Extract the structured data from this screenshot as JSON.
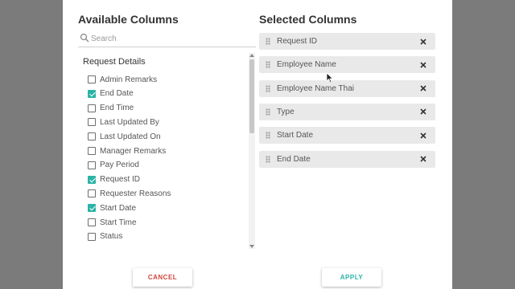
{
  "available_columns": {
    "title": "Available Columns",
    "search_placeholder": "Search",
    "group_title": "Request Details",
    "items": [
      {
        "label": "Admin Remarks",
        "checked": false
      },
      {
        "label": "End Date",
        "checked": true
      },
      {
        "label": "End Time",
        "checked": false
      },
      {
        "label": "Last Updated By",
        "checked": false
      },
      {
        "label": "Last Updated On",
        "checked": false
      },
      {
        "label": "Manager Remarks",
        "checked": false
      },
      {
        "label": "Pay Period",
        "checked": false
      },
      {
        "label": "Request ID",
        "checked": true
      },
      {
        "label": "Requester Reasons",
        "checked": false
      },
      {
        "label": "Start Date",
        "checked": true
      },
      {
        "label": "Start Time",
        "checked": false
      },
      {
        "label": "Status",
        "checked": false
      }
    ]
  },
  "selected_columns": {
    "title": "Selected Columns",
    "items": [
      "Request ID",
      "Employee Name",
      "Employee Name Thai",
      "Type",
      "Start Date",
      "End Date"
    ]
  },
  "buttons": {
    "cancel": "CANCEL",
    "apply": "APPLY"
  },
  "colors": {
    "accent": "#2bb3a6",
    "cancel": "#d2453a",
    "overlay": "#7b7b7b"
  }
}
